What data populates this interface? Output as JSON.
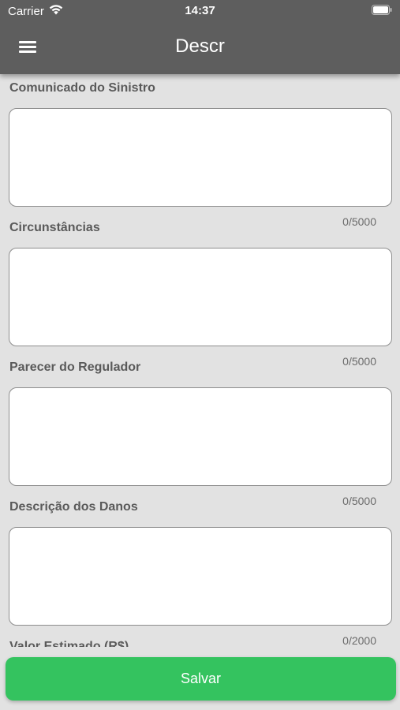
{
  "status_bar": {
    "carrier": "Carrier",
    "time": "14:37"
  },
  "header": {
    "title": "Descr",
    "menu_icon": "hamburger-menu-icon"
  },
  "fields": [
    {
      "label": "Comunicado do Sinistro",
      "value": "",
      "counter": "0/5000"
    },
    {
      "label": "Circunstâncias",
      "value": "",
      "counter": "0/5000"
    },
    {
      "label": "Parecer do Regulador",
      "value": "",
      "counter": "0/5000"
    },
    {
      "label": "Descrição dos Danos",
      "value": "",
      "counter": "0/2000"
    },
    {
      "label": "Valor Estimado (R$)"
    }
  ],
  "footer": {
    "save_label": "Salvar"
  },
  "colors": {
    "header": "#5e5e5e",
    "background": "#e2e2e2",
    "accent": "#34c35f"
  }
}
